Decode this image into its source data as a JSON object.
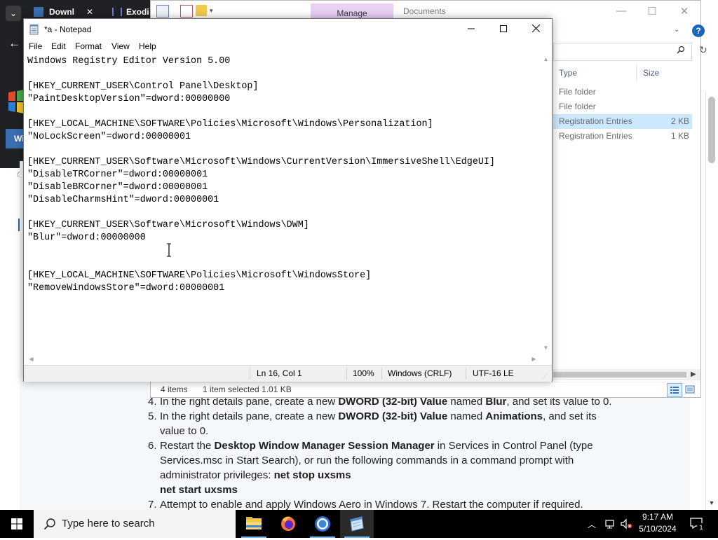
{
  "browser": {
    "tabs": [
      {
        "label": "Downl",
        "close": "✕"
      },
      {
        "label": "Exodi"
      }
    ],
    "sidebar_label": "Wi"
  },
  "article": {
    "steps": [
      {
        "num": "4.",
        "parts": [
          {
            "t": "In the right details pane, create a new "
          },
          {
            "t": "DWORD (32-bit) Value",
            "b": true
          },
          {
            "t": " named "
          },
          {
            "t": "Blur",
            "b": true
          },
          {
            "t": ", and set its value to 0."
          }
        ]
      },
      {
        "num": "5.",
        "parts": [
          {
            "t": "In the right details pane, create a new "
          },
          {
            "t": "DWORD (32-bit) Value",
            "b": true
          },
          {
            "t": " named "
          },
          {
            "t": "Animations",
            "b": true
          },
          {
            "t": ", and set its"
          }
        ],
        "line2": "value to 0."
      },
      {
        "num": "6.",
        "parts": [
          {
            "t": "Restart the "
          },
          {
            "t": "Desktop Window Manager Session Manager",
            "b": true
          },
          {
            "t": " in Services in Control Panel (type"
          }
        ],
        "line2": "Services.msc in Start Search), or run the following commands in a command prompt with",
        "line3_pre": "administrator privileges: ",
        "line3_b": "net stop uxsms",
        "line4_b": "net start uxsms"
      },
      {
        "num": "7.",
        "parts": [
          {
            "t": "Attempt to enable and apply Windows Aero in Windows 7. Restart the computer if required."
          }
        ]
      }
    ]
  },
  "explorer": {
    "manage_tab": "Manage",
    "documents_label": "Documents",
    "help": "?",
    "columns": {
      "type": "Type",
      "size": "Size"
    },
    "rows": [
      {
        "type": "File folder",
        "size": "",
        "selected": false
      },
      {
        "type": "File folder",
        "size": "",
        "selected": false
      },
      {
        "type": "Registration Entries",
        "size": "2 KB",
        "selected": true
      },
      {
        "type": "Registration Entries",
        "size": "1 KB",
        "selected": false
      }
    ],
    "status": {
      "count": "4 items",
      "selection": "1 item selected  1.01 KB"
    },
    "window_controls": {
      "minimize": "—",
      "maximize": "☐",
      "close": "✕"
    }
  },
  "notepad": {
    "title": "*a - Notepad",
    "menu": [
      "File",
      "Edit",
      "Format",
      "View",
      "Help"
    ],
    "content": "Windows Registry Editor Version 5.00\n\n[HKEY_CURRENT_USER\\Control Panel\\Desktop]\n\"PaintDesktopVersion\"=dword:00000000\n\n[HKEY_LOCAL_MACHINE\\SOFTWARE\\Policies\\Microsoft\\Windows\\Personalization]\n\"NoLockScreen\"=dword:00000001\n\n[HKEY_CURRENT_USER\\Software\\Microsoft\\Windows\\CurrentVersion\\ImmersiveShell\\EdgeUI]\n\"DisableTRCorner\"=dword:00000001\n\"DisableBRCorner\"=dword:00000001\n\"DisableCharmsHint\"=dword:00000001\n\n[HKEY_CURRENT_USER\\Software\\Microsoft\\Windows\\DWM]\n\"Blur\"=dword:00000000\n\n\n[HKEY_LOCAL_MACHINE\\SOFTWARE\\Policies\\Microsoft\\WindowsStore]\n\"RemoveWindowsStore\"=dword:00000001",
    "status": {
      "position": "Ln 16, Col 1",
      "zoom": "100%",
      "line_ending": "Windows (CRLF)",
      "encoding": "UTF-16 LE"
    }
  },
  "taskbar": {
    "search_placeholder": "Type here to search",
    "apps": [
      "file-explorer",
      "firefox",
      "chrome",
      "notepad"
    ],
    "time": "9:17 AM",
    "date": "5/10/2024",
    "notifications": "1"
  }
}
